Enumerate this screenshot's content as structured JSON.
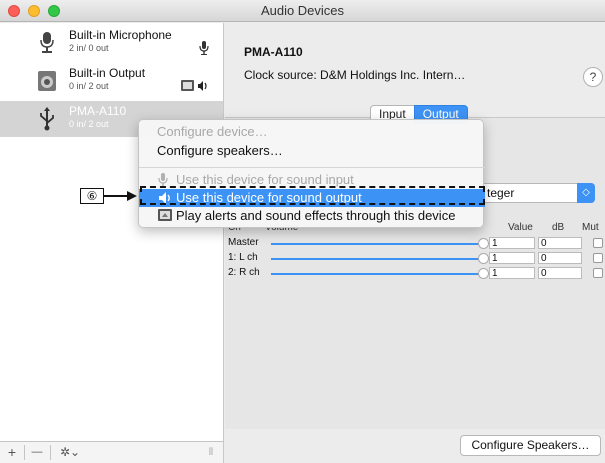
{
  "window": {
    "title": "Audio Devices"
  },
  "sidebar": {
    "devices": [
      {
        "name": "Built-in Microphone",
        "channels": "2 in/ 0 out"
      },
      {
        "name": "Built-in Output",
        "channels": "0 in/ 2 out"
      },
      {
        "name": "PMA-A110",
        "channels": "0 in/ 2 out"
      }
    ],
    "bottom": {
      "add": "+",
      "remove": "—",
      "settings": "✲⌄",
      "resize": "⫴"
    }
  },
  "main": {
    "device_title": "PMA-A110",
    "clock_source": "Clock source:  D&M Holdings Inc. Intern…",
    "help": "?",
    "tabs": [
      "Input",
      "Output"
    ],
    "format_value": "teger",
    "table_headers": [
      "Ch",
      "Volume",
      "Value",
      "dB",
      "Mut"
    ],
    "rows": [
      {
        "label": "Master",
        "value": "1",
        "db": "0"
      },
      {
        "label": "1: L ch",
        "value": "1",
        "db": "0"
      },
      {
        "label": "2: R ch",
        "value": "1",
        "db": "0"
      }
    ],
    "configure_button": "Configure Speakers…"
  },
  "menu": {
    "items": [
      {
        "label": "Configure device…",
        "state": "disabled"
      },
      {
        "label": "Configure speakers…",
        "state": "enabled"
      },
      {
        "label": "Use this device for sound input",
        "state": "disabled"
      },
      {
        "label": "Use this device for sound output",
        "state": "highlighted"
      },
      {
        "label": "Play alerts and sound effects through this device",
        "state": "enabled"
      }
    ]
  },
  "callout": {
    "number": "⑥"
  }
}
